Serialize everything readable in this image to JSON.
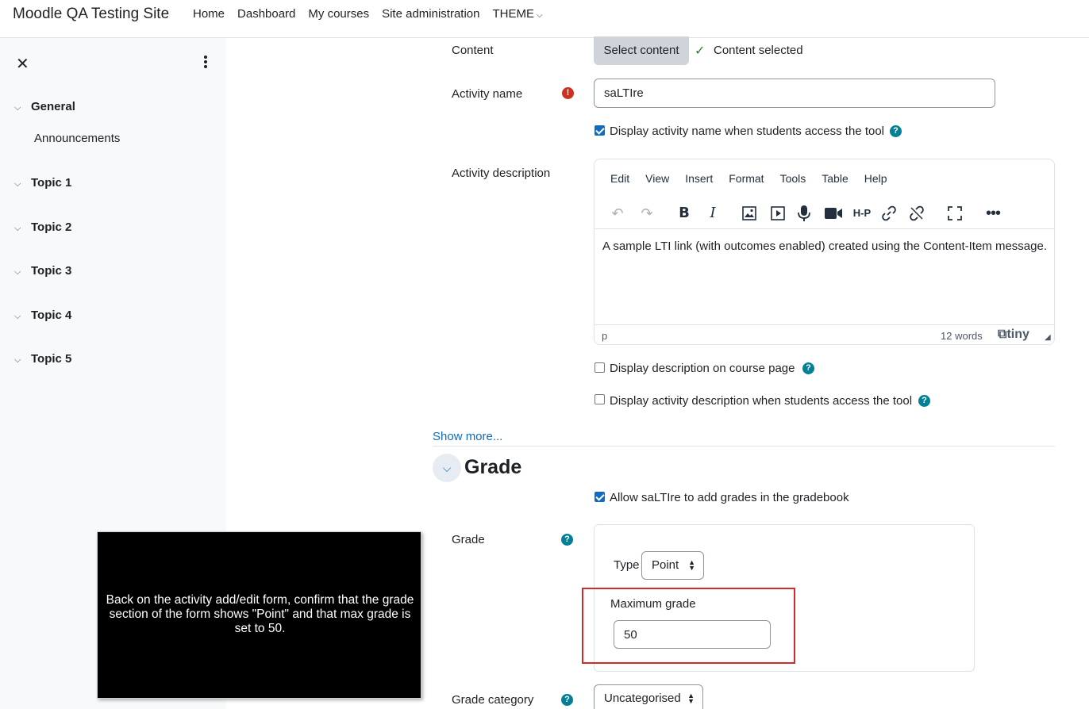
{
  "navbar": {
    "brand": "Moodle QA Testing Site",
    "links": [
      "Home",
      "Dashboard",
      "My courses",
      "Site administration",
      "THEME"
    ]
  },
  "drawer": {
    "sections": [
      "General",
      "Topic 1",
      "Topic 2",
      "Topic 3",
      "Topic 4",
      "Topic 5"
    ],
    "general_items": [
      "Announcements"
    ]
  },
  "form": {
    "content_label": "Content",
    "select_content_button": "Select content",
    "content_selected": "Content selected",
    "activity_name_label": "Activity name",
    "activity_name_value": "saLTIre",
    "display_name_checkbox": "Display activity name when students access the tool",
    "activity_description_label": "Activity description",
    "editor_menu": [
      "Edit",
      "View",
      "Insert",
      "Format",
      "Tools",
      "Table",
      "Help"
    ],
    "editor_content": "A sample LTI link (with outcomes enabled) created using the Content-Item message.",
    "editor_path": "p",
    "editor_wordcount": "12 words",
    "editor_brand": "tiny",
    "display_desc_course_page": "Display description on course page",
    "display_desc_tool": "Display activity description when students access the tool",
    "show_more": "Show more...",
    "grade_heading": "Grade",
    "allow_grades": "Allow saLTIre to add grades in the gradebook",
    "grade_label": "Grade",
    "type_label": "Type",
    "type_value": "Point",
    "max_grade_label": "Maximum grade",
    "max_grade_value": "50",
    "grade_category_label": "Grade category",
    "grade_category_value": "Uncategorised"
  },
  "overlay": {
    "text": "Back on the activity add/edit form, confirm that the grade section of the form shows \"Point\" and that max grade is set to 50."
  },
  "colors": {
    "accent": "#0f6cbf",
    "help": "#008196",
    "required": "#ca3120",
    "highlight": "#d42a2a"
  }
}
